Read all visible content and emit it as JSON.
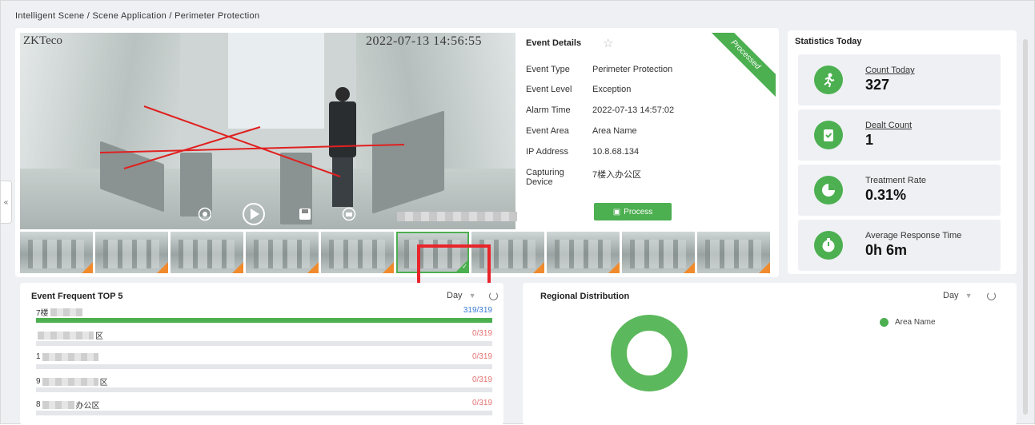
{
  "breadcrumb": "Intelligent Scene / Scene Application / Perimeter Protection",
  "collapse_icon": "«",
  "video": {
    "watermark": "ZKTeco",
    "timestamp": "2022-07-13 14:56:55",
    "controls": [
      "record-icon",
      "play-icon",
      "save-icon",
      "snapshot-icon"
    ]
  },
  "thumbnails": {
    "count": 10,
    "selected_index": 5
  },
  "event_details": {
    "title": "Event Details",
    "status": "Processed",
    "rows": [
      {
        "key": "Event Type",
        "value": "Perimeter Protection"
      },
      {
        "key": "Event Level",
        "value": "Exception"
      },
      {
        "key": "Alarm Time",
        "value": "2022-07-13 14:57:02"
      },
      {
        "key": "Event Area",
        "value": "Area Name"
      },
      {
        "key": "IP Address",
        "value": "10.8.68.134"
      },
      {
        "key": "Capturing Device",
        "value": "7楼入办公区"
      }
    ],
    "process_label": "Process"
  },
  "statistics": {
    "title": "Statistics Today",
    "items": [
      {
        "label": "Count Today",
        "value": "327",
        "icon": "running-person-icon"
      },
      {
        "label": "Dealt Count",
        "value": "1",
        "icon": "clipboard-check-icon"
      },
      {
        "label": "Treatment Rate",
        "value": "0.31%",
        "icon": "pie-chart-icon"
      },
      {
        "label": "Average Response Time",
        "value": "0h 6m",
        "icon": "stopwatch-icon"
      }
    ]
  },
  "top5": {
    "title": "Event Frequent TOP 5",
    "period": "Day",
    "rows": [
      {
        "name_start": "7楼",
        "name_end": "",
        "count": "319/319",
        "fraction": 1.0
      },
      {
        "name_start": "",
        "name_end": "区",
        "count": "0/319",
        "fraction": 0.0
      },
      {
        "name_start": "1",
        "name_end": "",
        "count": "0/319",
        "fraction": 0.0
      },
      {
        "name_start": "9",
        "name_end": "区",
        "count": "0/319",
        "fraction": 0.0
      },
      {
        "name_start": "8",
        "name_end": "办公区",
        "count": "0/319",
        "fraction": 0.0
      }
    ]
  },
  "regional": {
    "title": "Regional Distribution",
    "period": "Day",
    "legend": "Area Name",
    "chart_color": "#5cb85c"
  },
  "colors": {
    "accent": "#4caf50",
    "highlight": "#e8252b"
  }
}
